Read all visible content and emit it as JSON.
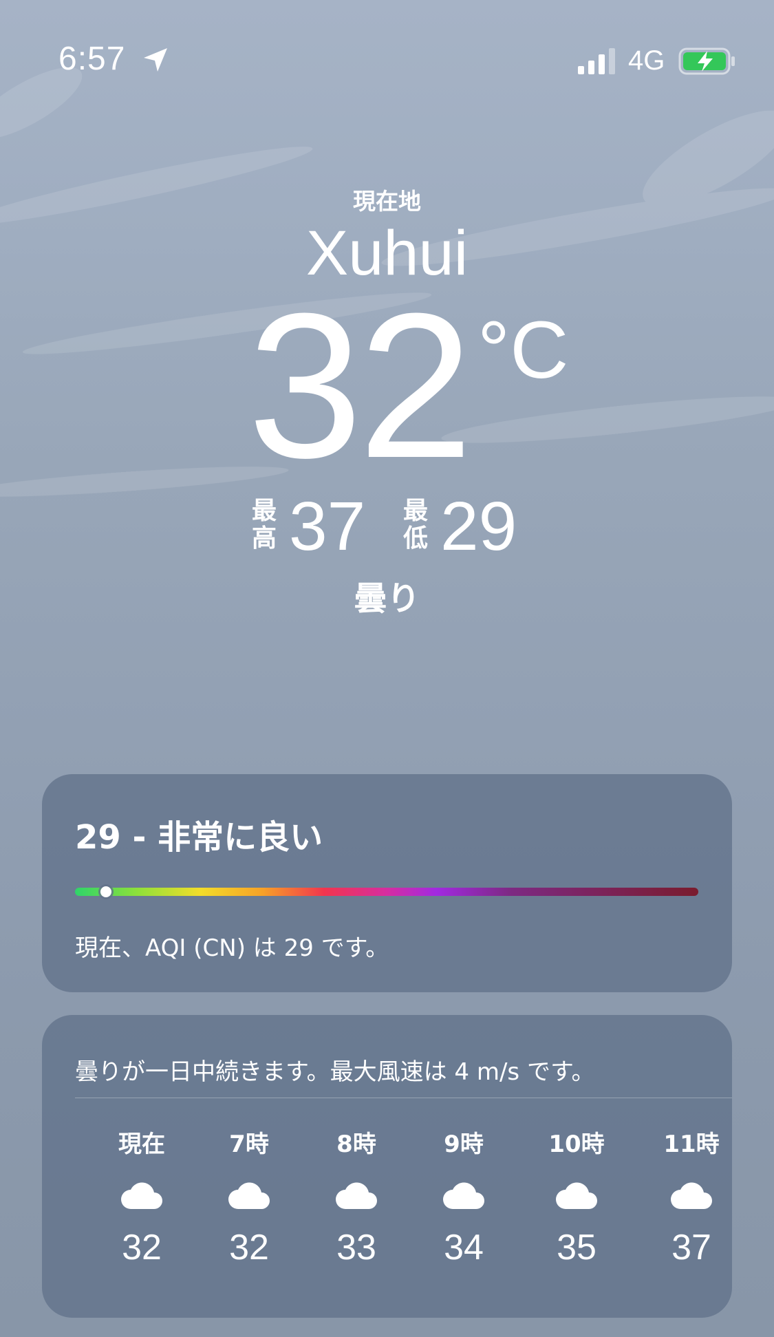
{
  "status_bar": {
    "time": "6:57",
    "network": "4G",
    "battery_color": "#34c759"
  },
  "hero": {
    "location_label": "現在地",
    "city": "Xuhui",
    "temperature": "32",
    "unit": "°C",
    "high_label_top": "最",
    "high_label_bottom": "高",
    "high": "37",
    "low_label_top": "最",
    "low_label_bottom": "低",
    "low": "29",
    "condition": "曇り"
  },
  "aqi": {
    "title": "29 - 非常に良い",
    "level_fraction": 0.05,
    "description": "現在、AQI (CN) は 29 です。"
  },
  "forecast": {
    "summary": "曇りが一日中続きます。最大風速は 4 m/s です。",
    "hours": [
      {
        "label": "現在",
        "icon": "cloud-icon",
        "temp": "32"
      },
      {
        "label": "7時",
        "icon": "cloud-icon",
        "temp": "32"
      },
      {
        "label": "8時",
        "icon": "cloud-icon",
        "temp": "33"
      },
      {
        "label": "9時",
        "icon": "cloud-icon",
        "temp": "34"
      },
      {
        "label": "10時",
        "icon": "cloud-icon",
        "temp": "35"
      },
      {
        "label": "11時",
        "icon": "cloud-icon",
        "temp": "37"
      }
    ]
  }
}
